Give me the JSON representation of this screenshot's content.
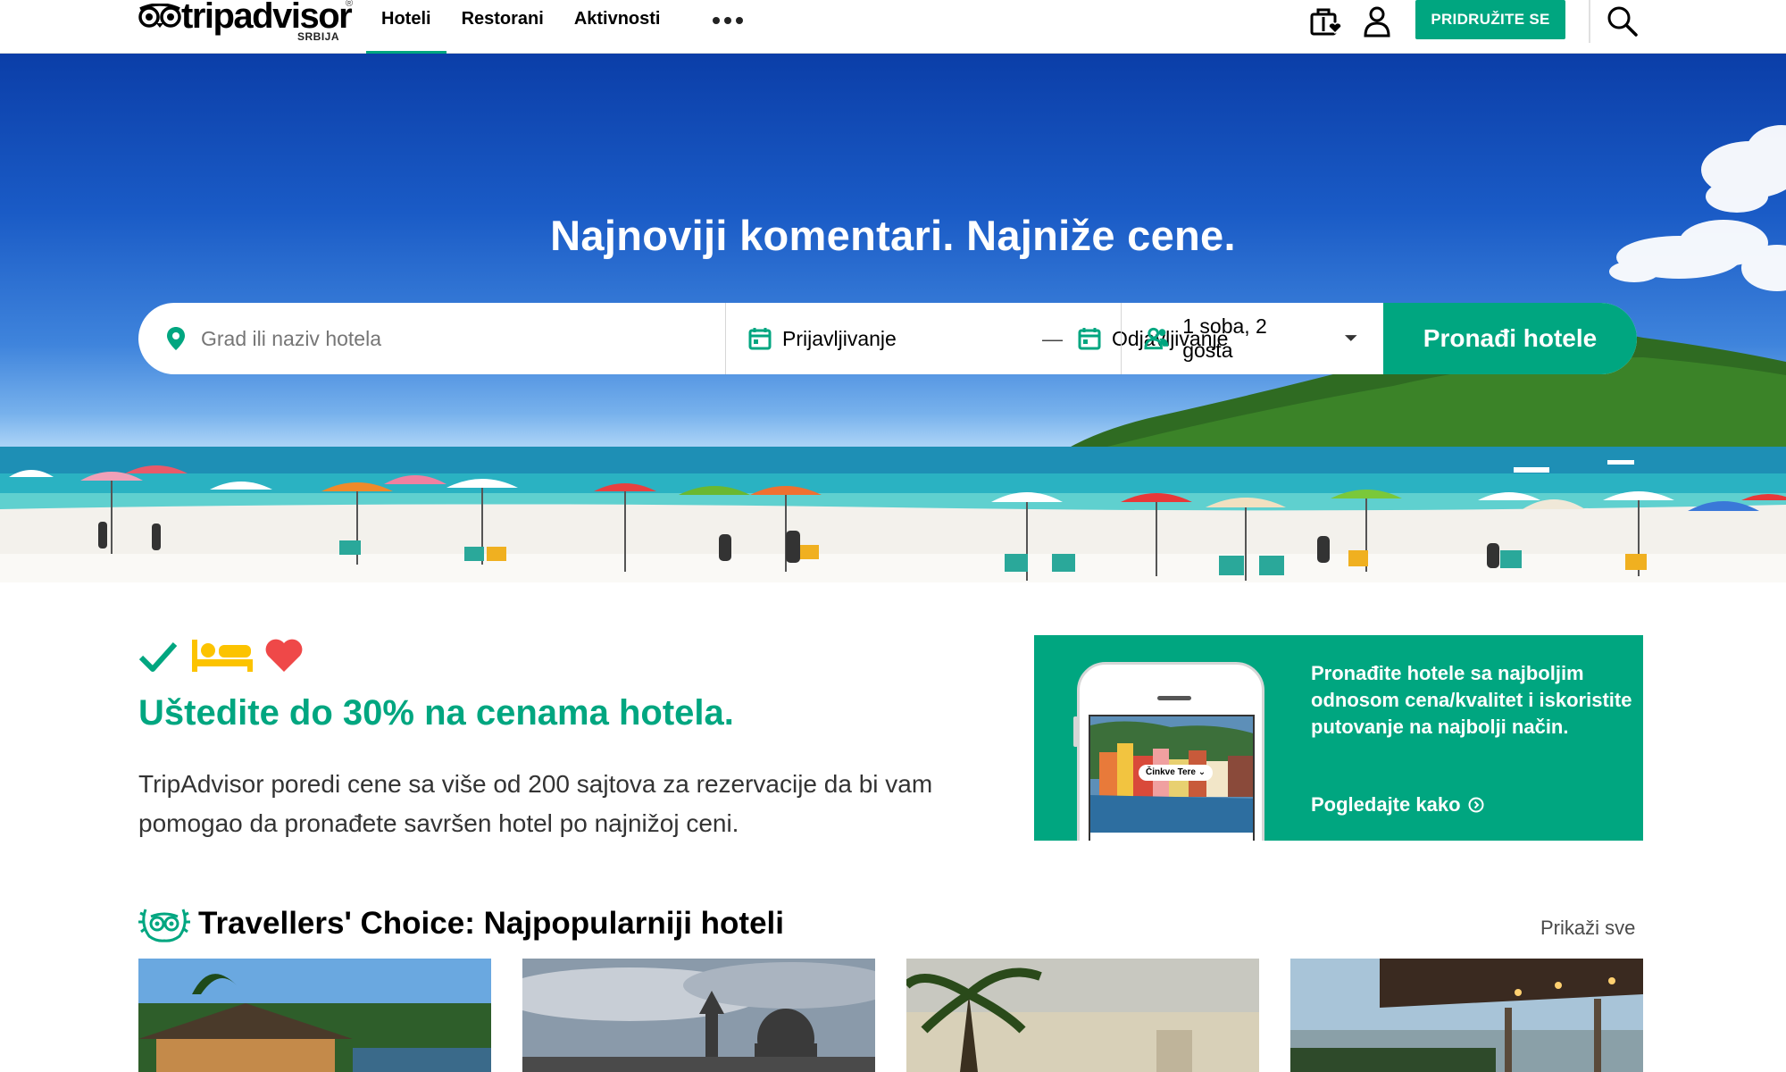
{
  "header": {
    "logo_wordmark": "tripadvisor",
    "logo_country": "SRBIJA",
    "nav": [
      {
        "label": "Hoteli",
        "active": true
      },
      {
        "label": "Restorani",
        "active": false
      },
      {
        "label": "Aktivnosti",
        "active": false
      }
    ],
    "more_icon": "more-dots-icon",
    "trips_icon": "suitcase-heart-icon",
    "profile_icon": "user-icon",
    "join_label": "PRIDRUŽITE SE",
    "search_icon": "search-icon"
  },
  "hero": {
    "title": "Najnoviji komentari. Najniže cene.",
    "search": {
      "destination_placeholder": "Grad ili naziv hotela",
      "checkin_label": "Prijavljivanje",
      "checkout_label": "Odjavljivanje",
      "guests_label": "1 soba, 2 gosta",
      "submit_label": "Pronađi hotele"
    }
  },
  "promo": {
    "icons": [
      "checkmark-icon",
      "bed-icon",
      "heart-icon"
    ],
    "title": "Uštedite do 30% na cenama hotela.",
    "text": "TripAdvisor poredi cene sa više od 200 sajtova za rezervacije da bi vam pomogao da pronađete savršen hotel po najnižoj ceni."
  },
  "app_card": {
    "text": "Pronađite hotele sa najboljim odnosom cena/kvalitet i iskoristite putovanje na najbolji način.",
    "link_label": "Pogledajte kako",
    "phone_city_label": "Činkve Tere ⌄"
  },
  "travellers_choice": {
    "title": "Travellers' Choice: Najpopularniji hoteli",
    "show_all_label": "Prikaži sve",
    "cards": [
      {
        "name": "hotel-card-1"
      },
      {
        "name": "hotel-card-2"
      },
      {
        "name": "hotel-card-3"
      },
      {
        "name": "hotel-card-4"
      }
    ]
  },
  "colors": {
    "brand_green": "#00a680",
    "heart_red": "#ef4848",
    "bed_yellow": "#fcc300"
  }
}
